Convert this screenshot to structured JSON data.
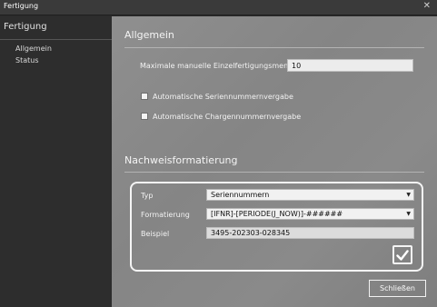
{
  "window": {
    "title": "Fertigung",
    "close_glyph": "✕"
  },
  "sidebar": {
    "heading": "Fertigung",
    "items": [
      {
        "label": "Allgemein"
      },
      {
        "label": "Status"
      }
    ]
  },
  "general": {
    "title": "Allgemein",
    "max_label": "Maximale manuelle Einzelfertigungsmenge",
    "max_value": "10",
    "auto_serial_label": "Automatische Seriennummernvergabe",
    "auto_serial_checked": false,
    "auto_batch_label": "Automatische Chargennummernvergabe",
    "auto_batch_checked": false
  },
  "formatting": {
    "title": "Nachweisformatierung",
    "type_label": "Typ",
    "type_value": "Seriennummern",
    "format_label": "Formatierung",
    "format_value": "[IFNR]-[PERIODE(J_NOW)]-######",
    "example_label": "Beispiel",
    "example_value": "3495-202303-028345",
    "confirm_icon": "checkmark-icon"
  },
  "footer": {
    "close_label": "Schließen"
  },
  "colors": {
    "titlebar": "#3a3a3a",
    "sidebar": "#2d2d2d",
    "panel": "#8a8a8a",
    "frame": "#f5f5f5"
  }
}
